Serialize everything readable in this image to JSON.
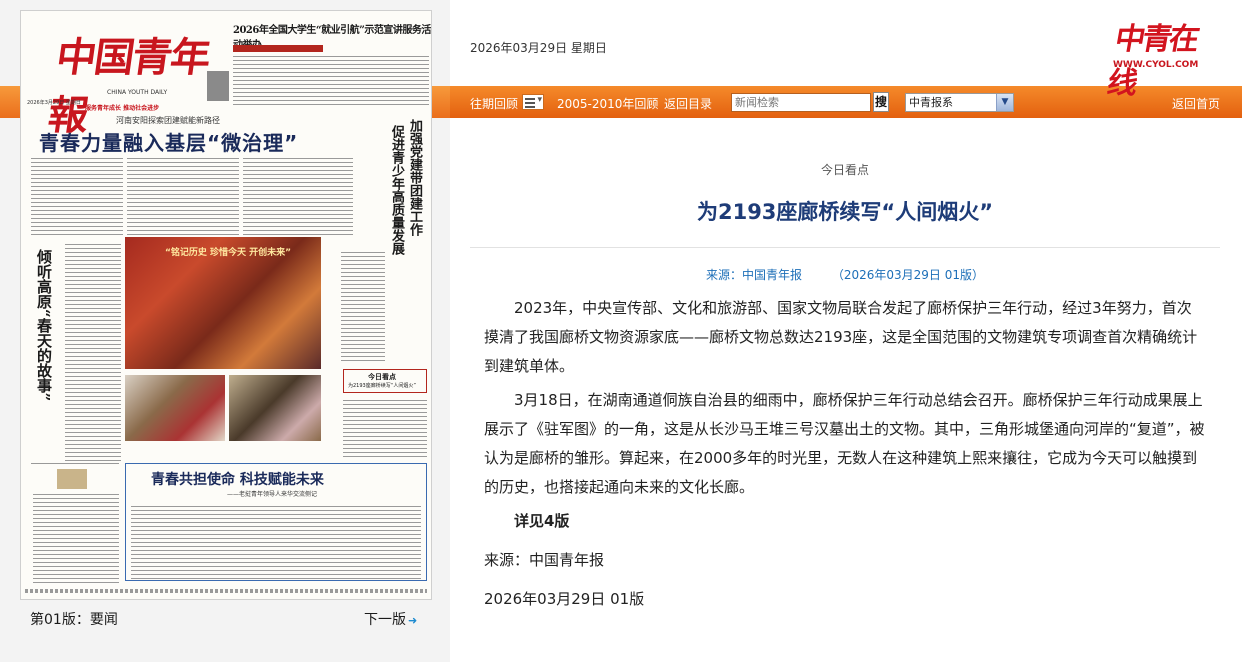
{
  "header": {
    "date": "2026年03月29日 星期日",
    "brand_logo": "中青在线",
    "brand_url": "WWW.CYOL.COM"
  },
  "nav": {
    "past_review": "往期回顾",
    "archive_range": "2005-2010年回顾",
    "back_to_toc": "返回目录",
    "search_placeholder": "新闻检索",
    "search_button": "搜",
    "paper_select": "中青报系",
    "back_home": "返回首页"
  },
  "newspaper": {
    "masthead": "中国青年報",
    "masthead_en": "CHINA YOUTH DAILY",
    "issue_date": "2026年3月29日 星期日",
    "slogans": "服务青年成长 推动社会进步",
    "top_headline": "2026年全国大学生“就业引航”示范宣讲服务活动举办",
    "banner_sub": "河南安阳探索团建赋能新路径",
    "banner": "青春力量融入基层“微治理”",
    "vertical_headline_1": "加强党建带团建工作",
    "vertical_headline_2": "促进青少年高质量发展",
    "vertical_headline_3": "阿东在河南调研共青团工作时强调",
    "left_vertical": "倾听高原“春天的故事”",
    "photo_banner": "“铭记历史 珍惜今天 开创未来”",
    "today_box_title": "今日看点",
    "today_box_text": "为2193座廊桥续写“人间烟火”",
    "bottom_headline": "青春共担使命 科技赋能未来",
    "bottom_sub": "——老挝青年领导人来华交流侧记"
  },
  "page_nav": {
    "current_page": "第01版：要闻",
    "next_page": "下一版"
  },
  "article": {
    "section": "今日看点",
    "title": "为2193座廊桥续写“人间烟火”",
    "source_line": "来源：中国青年报",
    "date_line": "（2026年03月29日 01版）",
    "paragraphs": [
      "2023年，中央宣传部、文化和旅游部、国家文物局联合发起了廊桥保护三年行动，经过3年努力，首次摸清了我国廊桥文物资源家底——廊桥文物总数达2193座，这是全国范围的文物建筑专项调查首次精确统计到建筑单体。",
      "3月18日，在湖南通道侗族自治县的细雨中，廊桥保护三年行动总结会召开。廊桥保护三年行动成果展上展示了《驻军图》的一角，这是从长沙马王堆三号汉墓出土的文物。其中，三角形城堡通向河岸的“复道”，被认为是廊桥的雏形。算起来，在2000多年的时光里，无数人在这种建筑上熙来攘往，它成为今天可以触摸到的历史，也搭接起通向未来的文化长廊。"
    ],
    "see_more": "详见4版",
    "footer_source": "来源：中国青年报",
    "footer_date": "2026年03月29日  01版"
  },
  "colors": {
    "nav_orange": "#e96a1a",
    "title_blue": "#1e3c78",
    "meta_blue": "#1d6fb8",
    "brand_red": "#d2141e"
  }
}
